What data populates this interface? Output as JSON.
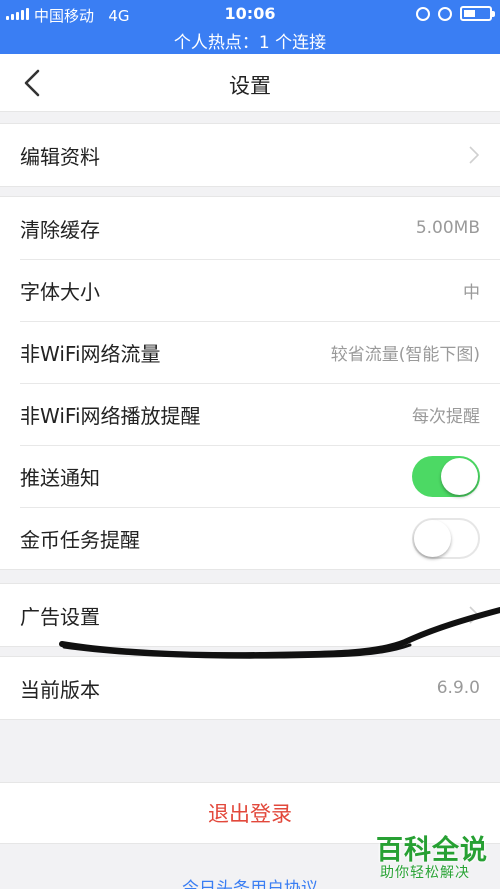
{
  "status_bar": {
    "carrier": "中国移动",
    "network": "4G",
    "time": "10:06",
    "hotspot_text": "个人热点：1 个连接",
    "battery_level": 0.45,
    "icons": [
      "signal-icon",
      "rotation-lock-icon",
      "alarm-icon",
      "battery-icon"
    ]
  },
  "nav": {
    "title": "设置",
    "back_icon": "chevron-left-icon"
  },
  "groups": {
    "profile": {
      "edit_profile": "编辑资料"
    },
    "general": {
      "clear_cache": {
        "label": "清除缓存",
        "value": "5.00MB"
      },
      "font_size": {
        "label": "字体大小",
        "value": "中"
      },
      "non_wifi_traffic": {
        "label": "非WiFi网络流量",
        "value": "较省流量(智能下图)"
      },
      "non_wifi_play_alert": {
        "label": "非WiFi网络播放提醒",
        "value": "每次提醒"
      },
      "push_notifications": {
        "label": "推送通知",
        "enabled": true
      },
      "coin_task_reminder": {
        "label": "金币任务提醒",
        "enabled": false
      }
    },
    "ads": {
      "ad_settings": "广告设置"
    },
    "version": {
      "label": "当前版本",
      "value": "6.9.0"
    }
  },
  "logout": "退出登录",
  "agreement": "今日头条用户协议",
  "watermark": {
    "main": "百科全说",
    "sub": "助你轻松解决"
  },
  "colors": {
    "status_bar": "#3a7ef3",
    "toggle_on": "#4cd964",
    "logout_text": "#e2483b",
    "link": "#3a7ef3",
    "watermark": "#27a033"
  }
}
